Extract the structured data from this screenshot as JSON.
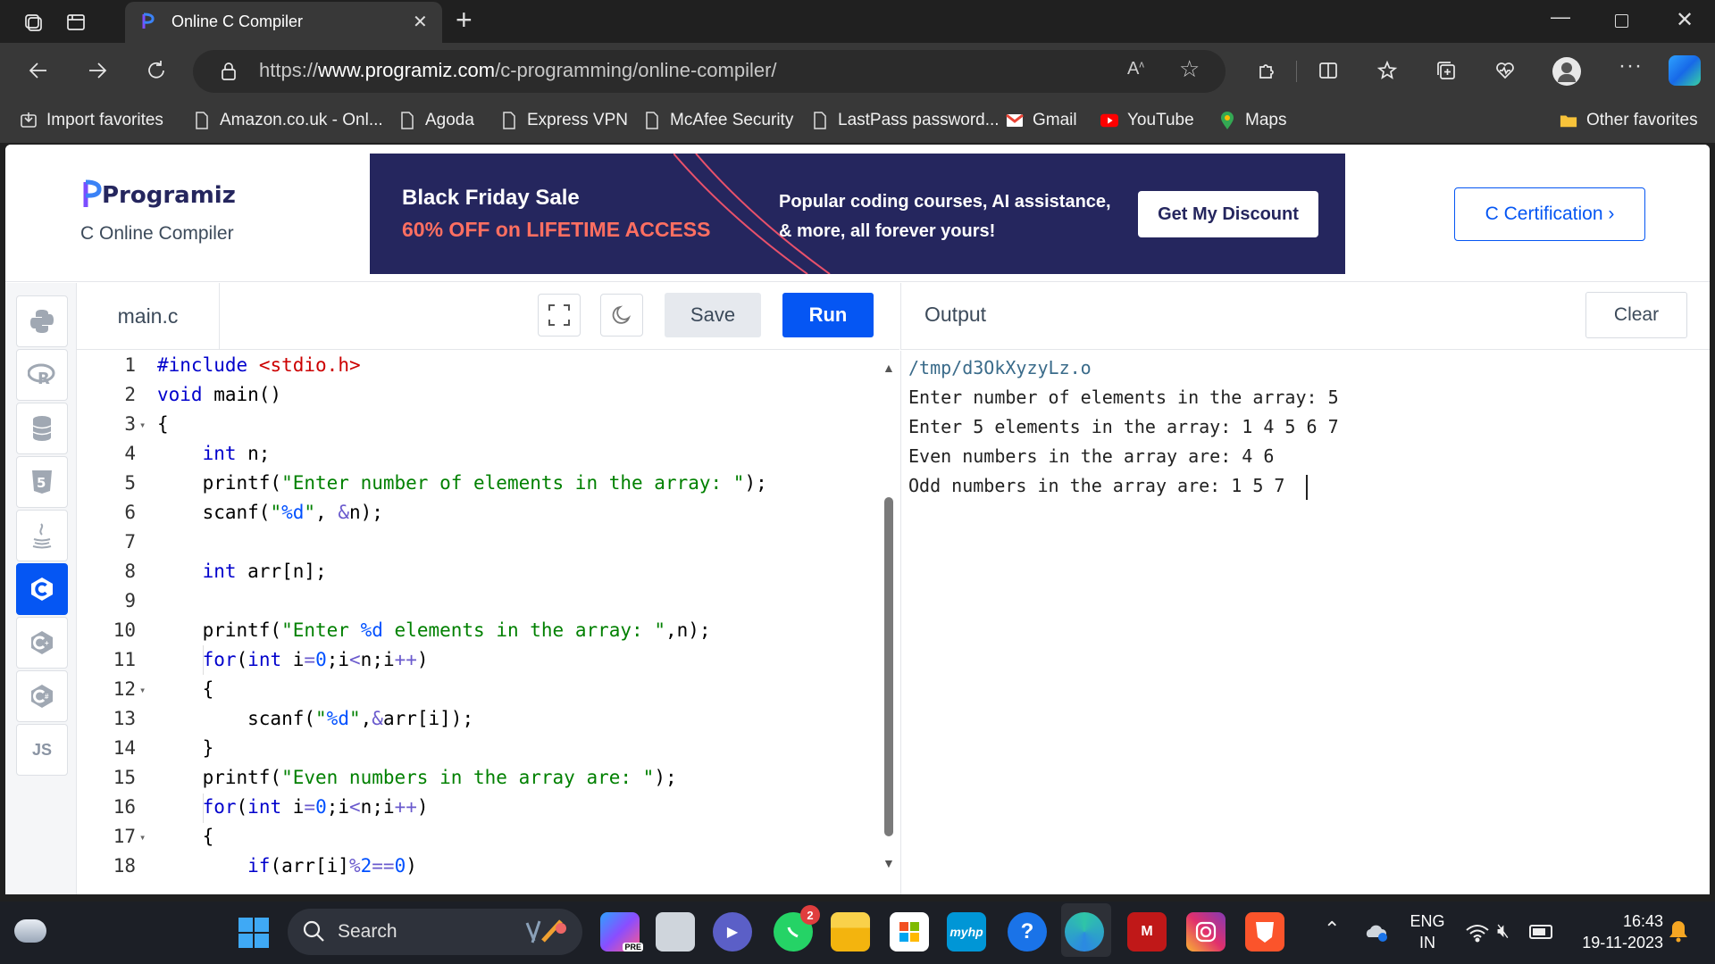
{
  "browser": {
    "tab_title": "Online C Compiler",
    "url_prefix": "https://",
    "url_domain": "www.programiz.com",
    "url_path": "/c-programming/online-compiler/",
    "bookmarks": [
      {
        "label": "Import favorites",
        "icon": "import-icon"
      },
      {
        "label": "Amazon.co.uk - Onl...",
        "icon": "page-icon"
      },
      {
        "label": "Agoda",
        "icon": "page-icon"
      },
      {
        "label": "Express VPN",
        "icon": "page-icon"
      },
      {
        "label": "McAfee Security",
        "icon": "page-icon"
      },
      {
        "label": "LastPass password...",
        "icon": "page-icon"
      },
      {
        "label": "Gmail",
        "icon": "gmail-icon"
      },
      {
        "label": "YouTube",
        "icon": "youtube-icon"
      },
      {
        "label": "Maps",
        "icon": "maps-icon"
      }
    ],
    "other_favorites": "Other favorites"
  },
  "header": {
    "logo": "Programiz",
    "subtitle": "C Online Compiler",
    "banner_title": "Black Friday Sale",
    "banner_offer": "60% OFF on LIFETIME ACCESS",
    "banner_text": "Popular coding courses, AI assistance, & more, all forever yours!",
    "banner_button": "Get My Discount",
    "cert_button": "C Certification ›"
  },
  "languages": [
    "python",
    "r",
    "sql",
    "html5",
    "java",
    "c",
    "cpp",
    "csharp",
    "js"
  ],
  "editor": {
    "filename": "main.c",
    "save_label": "Save",
    "run_label": "Run",
    "line_numbers": [
      "1",
      "2",
      "3",
      "4",
      "5",
      "6",
      "7",
      "8",
      "9",
      "10",
      "11",
      "12",
      "13",
      "14",
      "15",
      "16",
      "17",
      "18"
    ],
    "code_lines": [
      "#include <stdio.h>",
      "void main()",
      "{",
      "    int n;",
      "    printf(\"Enter number of elements in the array: \");",
      "    scanf(\"%d\", &n);",
      "",
      "    int arr[n];",
      "",
      "    printf(\"Enter %d elements in the array: \",n);",
      "    for(int i=0;i<n;i++)",
      "    {",
      "        scanf(\"%d\",&arr[i]);",
      "    }",
      "    printf(\"Even numbers in the array are: \");",
      "    for(int i=0;i<n;i++)",
      "    {",
      "        if(arr[i]%2==0)"
    ]
  },
  "output": {
    "title": "Output",
    "clear_label": "Clear",
    "lines": [
      "/tmp/d3OkXyzyLz.o",
      "Enter number of elements in the array: 5",
      "Enter 5 elements in the array: 1 4 5 6 7",
      "Even numbers in the array are: 4 6",
      "Odd numbers in the array are: 1 5 7 "
    ]
  },
  "taskbar": {
    "search_label": "Search",
    "whatsapp_badge": "2",
    "lang_line1": "ENG",
    "lang_line2": "IN",
    "time": "16:43",
    "date": "19-11-2023"
  },
  "colors": {
    "accent": "#0556f3",
    "brand_dark": "#25265e",
    "offer": "#ff6f61"
  }
}
